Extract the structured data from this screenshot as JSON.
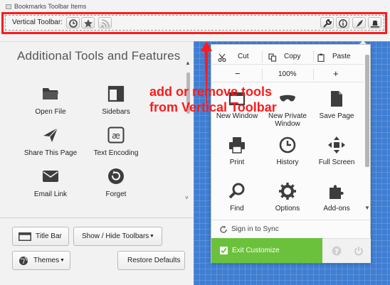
{
  "top": {
    "bookmarks_item_label": "Bookmarks Toolbar Items",
    "vertical_toolbar_label": "Vertical Toolbar:",
    "left_buttons": [
      "clock-icon",
      "star-icon",
      "rss-icon"
    ],
    "right_buttons": [
      "wrench-icon",
      "info-icon",
      "quill-icon",
      "hat-icon"
    ]
  },
  "left_panel": {
    "title": "Additional Tools and Features",
    "tools": [
      {
        "label": "Open File",
        "icon": "folder-icon"
      },
      {
        "label": "Sidebars",
        "icon": "sidebar-icon"
      },
      {
        "label": "Share This Page",
        "icon": "paper-plane-icon"
      },
      {
        "label": "Text Encoding",
        "icon": "encoding-icon"
      },
      {
        "label": "Email Link",
        "icon": "envelope-icon"
      },
      {
        "label": "Forget",
        "icon": "forget-icon"
      }
    ],
    "buttons": {
      "title_bar": "Title Bar",
      "show_hide_toolbars": "Show / Hide Toolbars",
      "themes": "Themes",
      "restore_defaults": "Restore Defaults"
    }
  },
  "menu": {
    "cut": "Cut",
    "copy": "Copy",
    "paste": "Paste",
    "zoom_out": "−",
    "zoom_level": "100%",
    "zoom_in": "+",
    "items": [
      {
        "label": "New Window",
        "icon": "window-icon"
      },
      {
        "label": "New Private Window",
        "icon": "mask-icon"
      },
      {
        "label": "Save Page",
        "icon": "save-page-icon"
      },
      {
        "label": "Print",
        "icon": "printer-icon"
      },
      {
        "label": "History",
        "icon": "history-icon"
      },
      {
        "label": "Full Screen",
        "icon": "fullscreen-icon"
      },
      {
        "label": "Find",
        "icon": "magnifier-icon"
      },
      {
        "label": "Options",
        "icon": "gear-icon"
      },
      {
        "label": "Add-ons",
        "icon": "puzzle-icon"
      }
    ],
    "sign_in": "Sign in to Sync",
    "exit_customize": "Exit Customize"
  },
  "annotation": {
    "line1": "add or remove tools",
    "line2": "from Vertical Toolbar"
  },
  "colors": {
    "highlight": "#ff1a1a",
    "grid_blue": "#3f7ed2",
    "exit_green": "#6bc13c"
  }
}
